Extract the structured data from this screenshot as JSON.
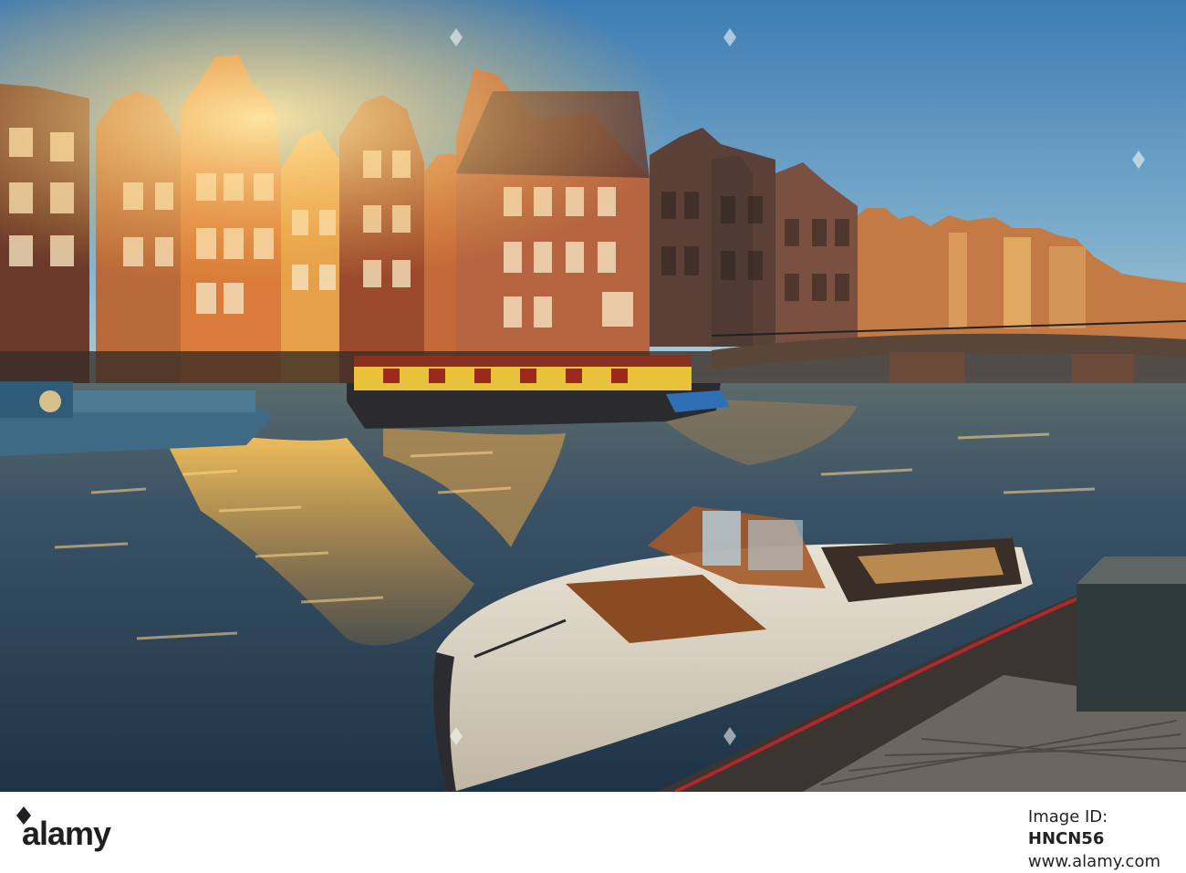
{
  "watermark": {
    "brand": "alamy",
    "image_id_label": "Image ID:",
    "image_id": "HNCN56",
    "site": "www.alamy.com"
  },
  "scene": {
    "subject": "canal-houses-at-sunset",
    "colors": {
      "sky_top": "#3f7fb5",
      "sky_bottom": "#9cc3d8",
      "water": "#3c5a6f",
      "gold": "#f3b642"
    }
  }
}
